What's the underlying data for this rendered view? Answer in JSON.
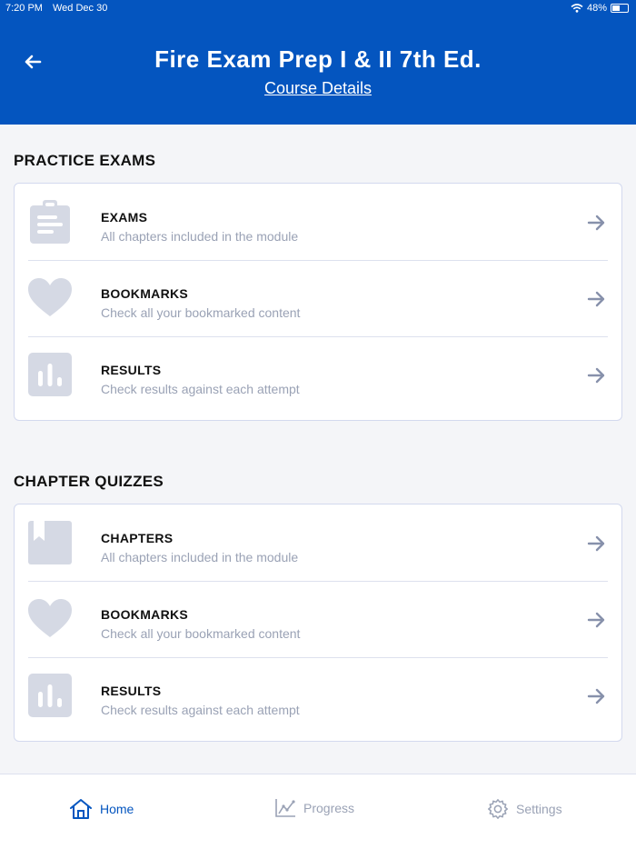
{
  "status": {
    "time": "7:20 PM",
    "date": "Wed Dec 30",
    "battery": "48%",
    "battery_level": 0.48
  },
  "header": {
    "title": "Fire Exam Prep I & II 7th Ed.",
    "link": "Course Details",
    "back_icon": "arrow-left-icon"
  },
  "practice": {
    "heading": "PRACTICE EXAMS",
    "items": [
      {
        "title": "EXAMS",
        "subtitle": "All chapters included in the module",
        "icon": "clipboard-icon"
      },
      {
        "title": "BOOKMARKS",
        "subtitle": "Check all your bookmarked content",
        "icon": "heart-icon"
      },
      {
        "title": "RESULTS",
        "subtitle": "Check results against each attempt",
        "icon": "bar-chart-icon"
      }
    ]
  },
  "quizzes": {
    "heading": "CHAPTER QUIZZES",
    "items": [
      {
        "title": "CHAPTERS",
        "subtitle": "All chapters included in the module",
        "icon": "book-icon"
      },
      {
        "title": "BOOKMARKS",
        "subtitle": "Check all your bookmarked content",
        "icon": "heart-icon"
      },
      {
        "title": "RESULTS",
        "subtitle": "Check results against each attempt",
        "icon": "bar-chart-icon"
      }
    ]
  },
  "tabs": [
    {
      "label": "Home",
      "icon": "home-icon",
      "active": true
    },
    {
      "label": "Progress",
      "icon": "trend-chart-icon",
      "active": false
    },
    {
      "label": "Settings",
      "icon": "gear-icon",
      "active": false
    }
  ],
  "colors": {
    "brand": "#0455bf",
    "icon_gray": "#d5d9e4",
    "arrow": "#8791ab",
    "muted_text": "#9aa2b5"
  }
}
